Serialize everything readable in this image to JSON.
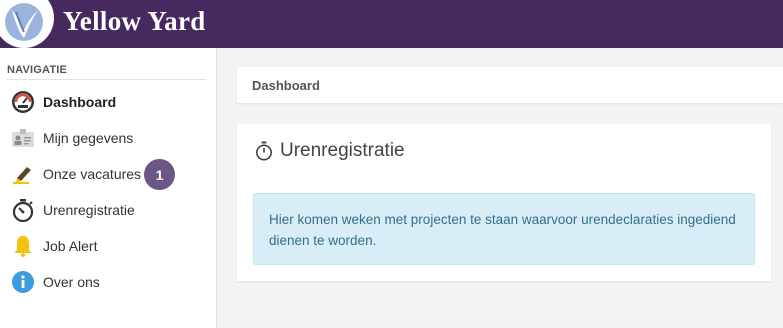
{
  "header": {
    "brand": "Yellow Yard",
    "logo_icon": "yellow-yard-logo",
    "background": "#45295f"
  },
  "sidebar": {
    "heading": "NAVIGATIE",
    "items": [
      {
        "label": "Dashboard",
        "icon": "dashboard-gauge-icon",
        "active": true
      },
      {
        "label": "Mijn gegevens",
        "icon": "id-card-icon",
        "active": false
      },
      {
        "label": "Onze vacatures",
        "icon": "pen-icon",
        "active": false,
        "badge": "1"
      },
      {
        "label": "Urenregistratie",
        "icon": "stopwatch-icon",
        "active": false
      },
      {
        "label": "Job Alert",
        "icon": "bell-icon",
        "active": false
      },
      {
        "label": "Over ons",
        "icon": "info-icon",
        "active": false
      }
    ]
  },
  "main": {
    "breadcrumb": "Dashboard",
    "panel": {
      "title": "Urenregistratie",
      "title_icon": "stopwatch-outline-icon",
      "info_message": "Hier komen weken met projecten te staan waarvoor urendeclaraties ingediend dienen te worden."
    }
  },
  "colors": {
    "accent": "#45295f",
    "badge": "#6b5685",
    "info_bg": "#d9edf7",
    "info_text": "#31708f"
  }
}
